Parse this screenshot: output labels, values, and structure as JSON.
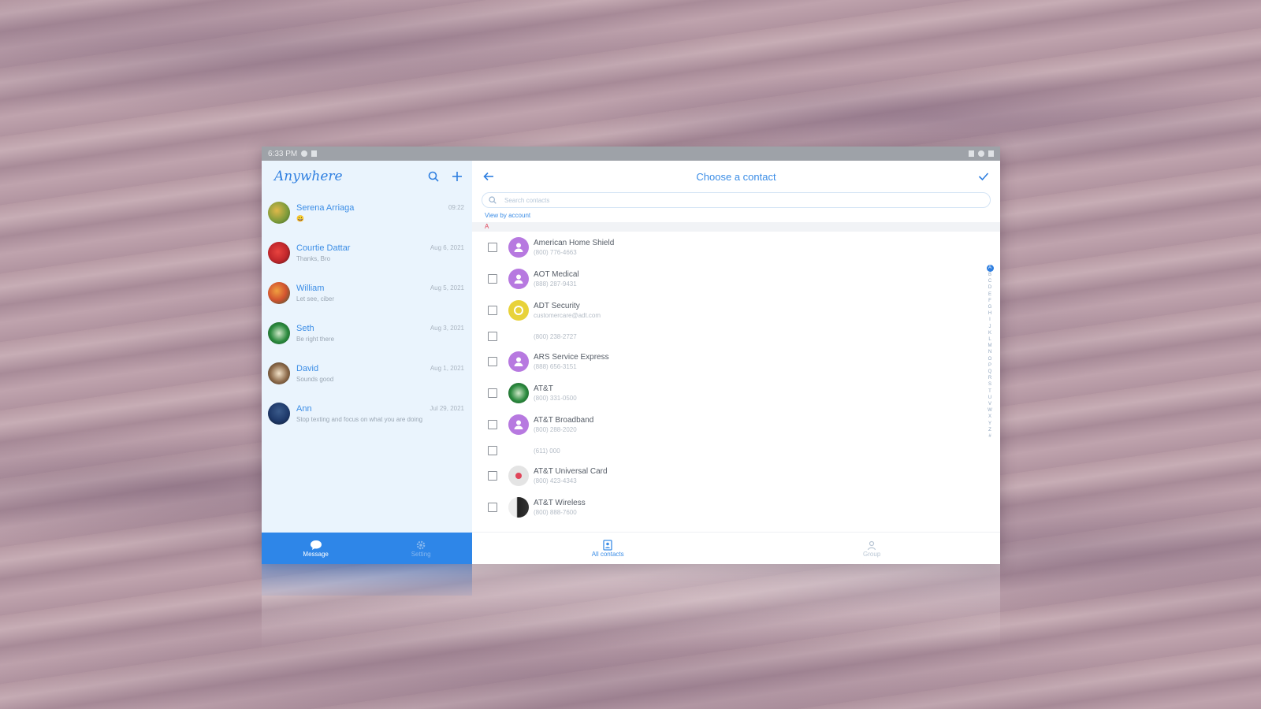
{
  "status_bar": {
    "time": "6:33 PM"
  },
  "app": {
    "brand": "Anywhere"
  },
  "conversations": [
    {
      "name": "Serena Arriaga",
      "date": "09:22",
      "preview": "😀",
      "color": "#7a9a3a"
    },
    {
      "name": "Courtie Dattar",
      "date": "Aug 6, 2021",
      "preview": "Thanks, Bro",
      "color": "#c0262b"
    },
    {
      "name": "William",
      "date": "Aug 5, 2021",
      "preview": "Let see, ciber",
      "color": "#d2532f"
    },
    {
      "name": "Seth",
      "date": "Aug 3, 2021",
      "preview": "Be right there",
      "color": "#2b8a3e"
    },
    {
      "name": "David",
      "date": "Aug 1, 2021",
      "preview": "Sounds good",
      "color": "#8c6a4a"
    },
    {
      "name": "Ann",
      "date": "Jul 29, 2021",
      "preview": "Stop texting and focus on what you are doing",
      "color": "#1f3a6b"
    }
  ],
  "left_nav": {
    "message_label": "Message",
    "setting_label": "Setting"
  },
  "right_header": {
    "title": "Choose a contact"
  },
  "search": {
    "placeholder": "Search contacts"
  },
  "view_by": "View by account",
  "section_letter": "A",
  "contacts": [
    {
      "name": "American Home Shield",
      "number": "(800) 776-4663",
      "avatar": "#b779e0"
    },
    {
      "name": "AOT Medical",
      "number": "(888) 287-9431",
      "avatar": "#b779e0"
    },
    {
      "name": "ADT Security",
      "number": "customercare@adt.com",
      "avatar": "#e8d23a"
    },
    {
      "name": "",
      "number": "(800) 238-2727",
      "avatar": ""
    },
    {
      "name": "ARS Service Express",
      "number": "(888) 656-3151",
      "avatar": "#b779e0"
    },
    {
      "name": "AT&T",
      "number": "(800) 331-0500",
      "avatar": "#2b8a3e"
    },
    {
      "name": "AT&T Broadband",
      "number": "(800) 288-2020",
      "avatar": "#b779e0"
    },
    {
      "name": "",
      "number": "(611) 000",
      "avatar": ""
    },
    {
      "name": "AT&T Universal Card",
      "number": "(800) 423-4343",
      "avatar": "#e4e4e4"
    },
    {
      "name": "AT&T Wireless",
      "number": "(800) 888-7600",
      "avatar": "#333333"
    }
  ],
  "alpha_index": [
    "A",
    "B",
    "C",
    "D",
    "E",
    "F",
    "G",
    "H",
    "I",
    "J",
    "K",
    "L",
    "M",
    "N",
    "O",
    "P",
    "Q",
    "R",
    "S",
    "T",
    "U",
    "V",
    "W",
    "X",
    "Y",
    "Z",
    "#"
  ],
  "right_nav": {
    "contacts_label": "All contacts",
    "group_label": "Group"
  },
  "colors": {
    "accent": "#2f7fe0",
    "nav_bg": "#2e86e8",
    "panel_bg": "#eaf4fd"
  }
}
